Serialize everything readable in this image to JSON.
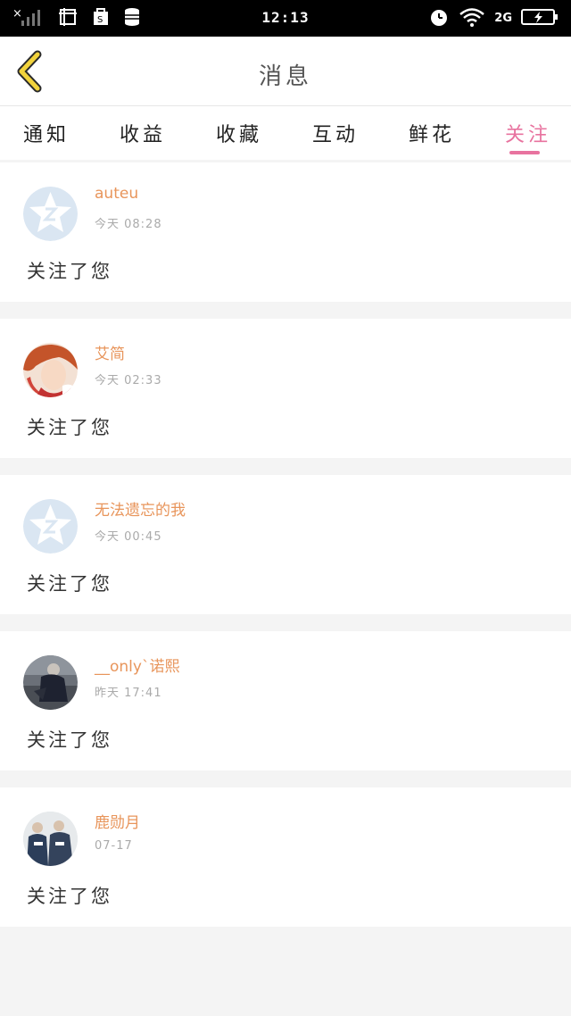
{
  "status_bar": {
    "time": "12:13",
    "battery": "⚡",
    "network": "2G"
  },
  "header": {
    "title": "消息"
  },
  "tabs": [
    {
      "label": "通知"
    },
    {
      "label": "收益"
    },
    {
      "label": "收藏"
    },
    {
      "label": "互动"
    },
    {
      "label": "鲜花"
    },
    {
      "label": "关注"
    }
  ],
  "active_tab": "关注",
  "colors": {
    "accent": "#e8739f",
    "username": "#e8955b",
    "back_arrow": "#f2d33c"
  },
  "messages": [
    {
      "username": "auteu",
      "time": "今天 08:28",
      "text": "关注了您",
      "avatar": "default-star-avatar"
    },
    {
      "username": "艾简",
      "time": "今天 02:33",
      "text": "关注了您",
      "avatar": "anime-red-hair-avatar"
    },
    {
      "username": "无法遗忘的我",
      "time": "今天 00:45",
      "text": "关注了您",
      "avatar": "default-star-avatar"
    },
    {
      "username": "__only`诺熙",
      "time": "昨天 17:41",
      "text": "关注了您",
      "avatar": "dark-figure-photo-avatar"
    },
    {
      "username": "鹿勋月",
      "time": "07-17",
      "text": "关注了您",
      "avatar": "group-photo-avatar"
    }
  ]
}
